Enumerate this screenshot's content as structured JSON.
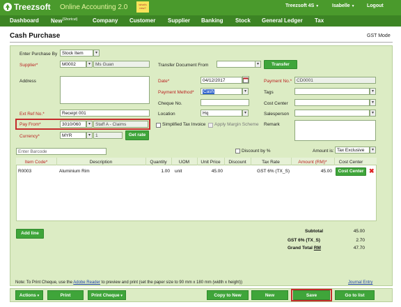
{
  "brand": {
    "name": "Treezsoft",
    "tagline": "Online Accounting 2.0",
    "whats_new": "what's new?"
  },
  "topbar": {
    "company": "Treezsoft 4S",
    "user": "Isabelle",
    "logout": "Logout",
    "caret": "▼"
  },
  "nav": {
    "dashboard": "Dashboard",
    "new": "New",
    "new_sup": "(Shortcut)",
    "company": "Company",
    "customer": "Customer",
    "supplier": "Supplier",
    "banking": "Banking",
    "stock": "Stock",
    "general_ledger": "General Ledger",
    "tax": "Tax"
  },
  "page": {
    "title": "Cash Purchase",
    "mode": "GST Mode"
  },
  "form": {
    "enter_purchase_by": {
      "label": "Enter Purchase By",
      "value": "Stock Item"
    },
    "supplier": {
      "label": "Supplier*",
      "code": "M0002",
      "name": "Ms Guan"
    },
    "transfer_doc": {
      "label": "Transfer Document From",
      "value": "",
      "button": "Transfer"
    },
    "address": {
      "label": "Address",
      "value": ""
    },
    "date": {
      "label": "Date*",
      "value": "04/12/2017"
    },
    "payment_no": {
      "label": "Payment No.*",
      "value": "CD0001"
    },
    "payment_method": {
      "label": "Payment Method*",
      "value": "Cash"
    },
    "tags": {
      "label": "Tags",
      "value": ""
    },
    "cheque_no": {
      "label": "Cheque No.",
      "value": ""
    },
    "cost_center": {
      "label": "Cost Center",
      "value": ""
    },
    "ext_ref": {
      "label": "Ext Ref No.*",
      "value": "Receipt 001"
    },
    "location": {
      "label": "Location",
      "value": "Hq"
    },
    "salesperson": {
      "label": "Salesperson",
      "value": ""
    },
    "pay_from": {
      "label": "Pay From*",
      "code": "3010/060",
      "name": "Staff A - Claims"
    },
    "simplified_tax": {
      "label": "Simplified Tax Invoice",
      "checked": false
    },
    "apply_margin": {
      "label": "Apply Margin Scheme",
      "checked": false
    },
    "remark": {
      "label": "Remark",
      "value": ""
    },
    "currency": {
      "label": "Currency*",
      "value": "MYR",
      "rate": "1",
      "button": "Get rate"
    },
    "barcode": {
      "placeholder": "Enter Barcode"
    },
    "discount_pct": {
      "label": "Discount by %",
      "checked": false
    },
    "amount_is": {
      "label": "Amount is:",
      "value": "Tax Exclusive"
    }
  },
  "table": {
    "headers": [
      "Item Code*",
      "Description",
      "Quantity",
      "UOM",
      "Unit Price",
      "Discount",
      "Tax Rate",
      "Amount (RM)*",
      "Cost Center"
    ],
    "rows": [
      {
        "item_code": "R0003",
        "description": "Aluminium Rim",
        "quantity": "1.00",
        "uom": "unit",
        "unit_price": "45.00",
        "discount": "",
        "tax_rate": "GST 6% (TX_S)",
        "amount": "45.00",
        "cost_center_btn": "Cost Center",
        "delete": "✖"
      }
    ]
  },
  "add_line": "Add line",
  "totals": {
    "subtotal_label": "Subtotal",
    "subtotal": "45.00",
    "gst_label": "GST 6% (TX_S)",
    "gst": "2.70",
    "grand_label": "Grand Total",
    "grand_currency": "RM",
    "grand": "47.70"
  },
  "note": {
    "prefix": "Note: To Print Cheque, use the ",
    "link": "Adobe Reader",
    "suffix": " to preview and print (set the paper size to 90 mm x 180 mm (width x height))",
    "journal": "Journal Entry"
  },
  "footer": {
    "actions": "Actions",
    "print": "Print",
    "print_cheque": "Print Cheque",
    "copy_to_new": "Copy to New",
    "new": "New",
    "save": "Save",
    "go_to_list": "Go to list"
  },
  "colors": {
    "topbar": "#4a9a2c",
    "navbar": "#3c8424",
    "panel": "#dcecc4",
    "button": "#3fa53a",
    "highlight": "#c52b2b",
    "required": "#b22222"
  }
}
